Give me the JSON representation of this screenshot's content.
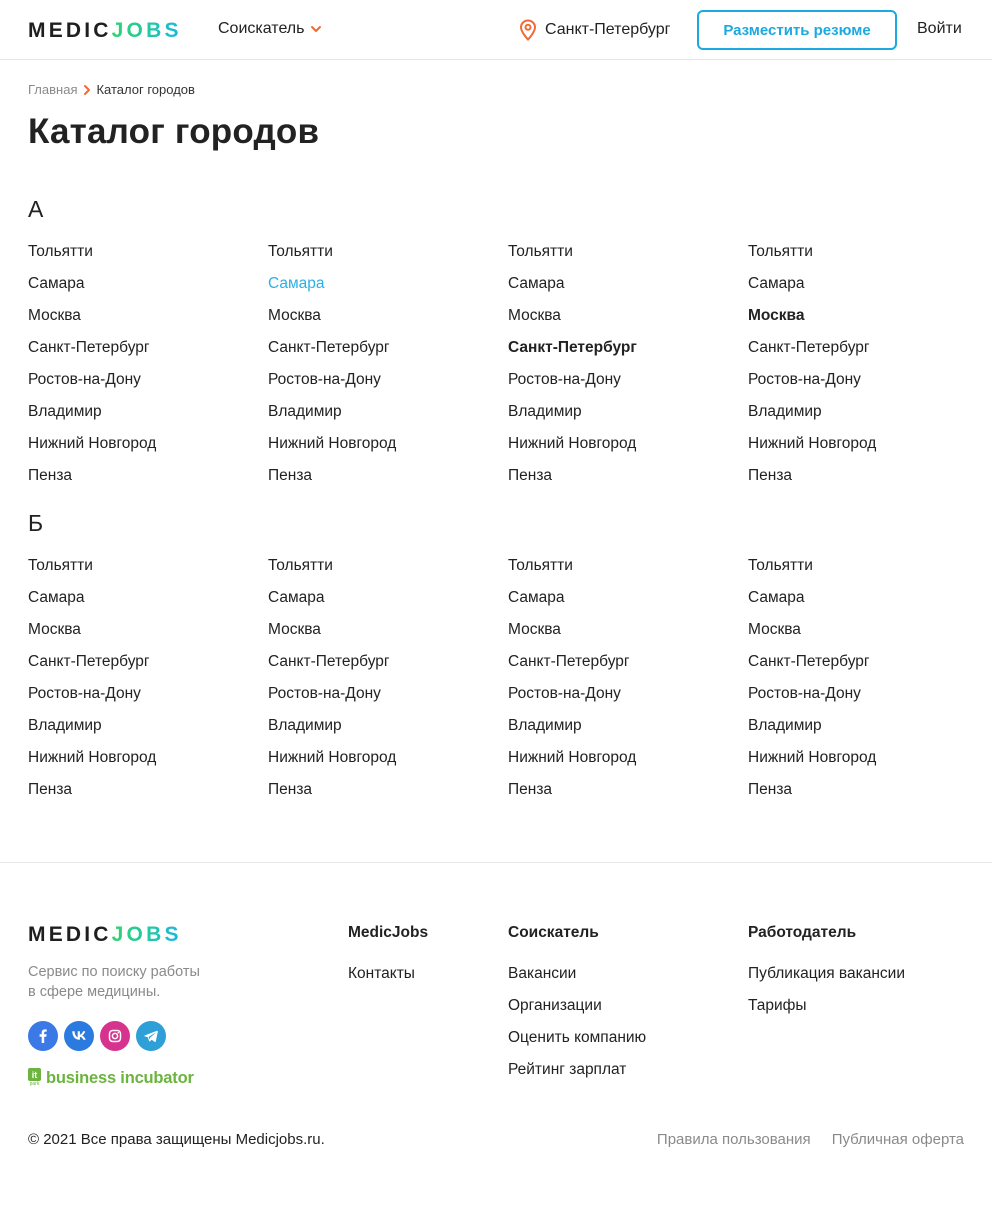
{
  "header": {
    "logo": {
      "part1": "MEDIC",
      "part2": "JOBS"
    },
    "role": "Соискатель",
    "location": "Санкт-Петербург",
    "post_resume": "Разместить резюме",
    "login": "Войти"
  },
  "breadcrumb": {
    "home": "Главная",
    "current": "Каталог городов"
  },
  "page_title": "Каталог городов",
  "sections": [
    {
      "letter": "А",
      "columns": [
        [
          "Тольятти",
          "Самара",
          "Москва",
          "Санкт-Петербург",
          "Ростов-на-Дону",
          "Владимир",
          "Нижний Новгород",
          "Пенза"
        ],
        [
          "Тольятти",
          "Самара",
          "Москва",
          "Санкт-Петербург",
          "Ростов-на-Дону",
          "Владимир",
          "Нижний Новгород",
          "Пенза"
        ],
        [
          "Тольятти",
          "Самара",
          "Москва",
          "Санкт-Петербург",
          "Ростов-на-Дону",
          "Владимир",
          "Нижний Новгород",
          "Пенза"
        ],
        [
          "Тольятти",
          "Самара",
          "Москва",
          "Санкт-Петербург",
          "Ростов-на-Дону",
          "Владимир",
          "Нижний Новгород",
          "Пенза"
        ]
      ]
    },
    {
      "letter": "Б",
      "columns": [
        [
          "Тольятти",
          "Самара",
          "Москва",
          "Санкт-Петербург",
          "Ростов-на-Дону",
          "Владимир",
          "Нижний Новгород",
          "Пенза"
        ],
        [
          "Тольятти",
          "Самара",
          "Москва",
          "Санкт-Петербург",
          "Ростов-на-Дону",
          "Владимир",
          "Нижний Новгород",
          "Пенза"
        ],
        [
          "Тольятти",
          "Самара",
          "Москва",
          "Санкт-Петербург",
          "Ростов-на-Дону",
          "Владимир",
          "Нижний Новгород",
          "Пенза"
        ],
        [
          "Тольятти",
          "Самара",
          "Москва",
          "Санкт-Петербург",
          "Ростов-на-Дону",
          "Владимир",
          "Нижний Новгород",
          "Пенза"
        ]
      ]
    }
  ],
  "footer": {
    "logo": {
      "part1": "MEDIC",
      "part2": "JOBS"
    },
    "tagline_line1": "Сервис по поиску работы",
    "tagline_line2": "в сфере медицины.",
    "socials": [
      "facebook-icon",
      "vk-icon",
      "instagram-icon",
      "telegram-icon"
    ],
    "incubator": {
      "mark": "it",
      "mark_sub": "park",
      "text": "business incubator"
    },
    "columns": [
      {
        "title": "MedicJobs",
        "links": [
          "Контакты"
        ]
      },
      {
        "title": "Соискатель",
        "links": [
          "Вакансии",
          "Организации",
          "Оценить компанию",
          "Рейтинг зарплат"
        ]
      },
      {
        "title": "Работодатель",
        "links": [
          "Публикация вакансии",
          "Тарифы"
        ]
      }
    ],
    "copyright": "© 2021 Все права защищены Medicjobs.ru.",
    "terms": "Правила пользования",
    "offer": "Публичная оферта"
  },
  "colors": {
    "accent": "#1aa9e0",
    "active_link": "#28b1e6",
    "location_pin": "#f06a35",
    "breadcrumb_chevron": "#f06a35",
    "incubator_green": "#6cb33f"
  }
}
